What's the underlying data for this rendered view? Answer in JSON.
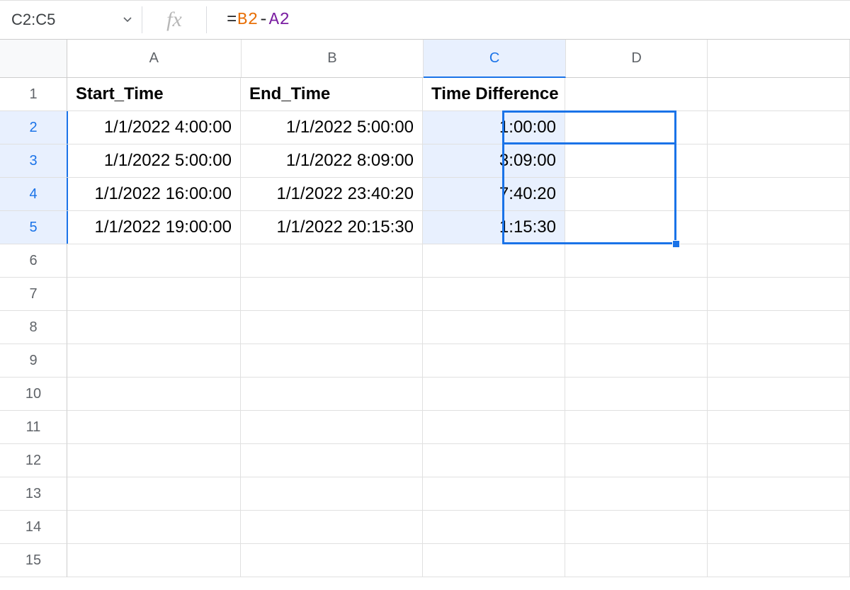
{
  "name_box": "C2:C5",
  "formula": {
    "eq": "=",
    "ref1": "B2",
    "op": "-",
    "ref2": "A2"
  },
  "columns": [
    "A",
    "B",
    "C",
    "D"
  ],
  "selected_column": "C",
  "row_count": 15,
  "selected_rows": [
    2,
    3,
    4,
    5
  ],
  "headers": {
    "A": "Start_Time",
    "B": "End_Time",
    "C": "Time Difference"
  },
  "data_rows": [
    {
      "A": "1/1/2022 4:00:00",
      "B": "1/1/2022 5:00:00",
      "C": "1:00:00"
    },
    {
      "A": "1/1/2022 5:00:00",
      "B": "1/1/2022 8:09:00",
      "C": "3:09:00"
    },
    {
      "A": "1/1/2022 16:00:00",
      "B": "1/1/2022 23:40:20",
      "C": "7:40:20"
    },
    {
      "A": "1/1/2022 19:00:00",
      "B": "1/1/2022 20:15:30",
      "C": "1:15:30"
    }
  ]
}
